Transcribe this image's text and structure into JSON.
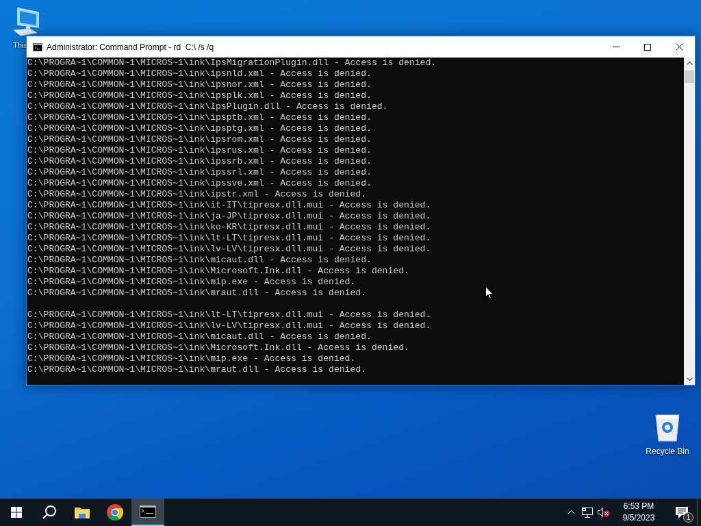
{
  "desktop_icons": [
    {
      "kind": "computer",
      "label": "This"
    },
    {
      "kind": "recycle-bin",
      "label": "Recycle Bin"
    }
  ],
  "window": {
    "title": "Administrator: Command Prompt - rd  C:\\ /s /q",
    "console_blocks": [
      [
        "C:\\PROGRA~1\\COMMON~1\\MICROS~1\\ink\\IpsMigrationPlugin.dll - Access is denied.",
        "C:\\PROGRA~1\\COMMON~1\\MICROS~1\\ink\\ipsnld.xml - Access is denied.",
        "C:\\PROGRA~1\\COMMON~1\\MICROS~1\\ink\\ipsnor.xml - Access is denied.",
        "C:\\PROGRA~1\\COMMON~1\\MICROS~1\\ink\\ipsplk.xml - Access is denied.",
        "C:\\PROGRA~1\\COMMON~1\\MICROS~1\\ink\\IpsPlugin.dll - Access is denied.",
        "C:\\PROGRA~1\\COMMON~1\\MICROS~1\\ink\\ipsptb.xml - Access is denied.",
        "C:\\PROGRA~1\\COMMON~1\\MICROS~1\\ink\\ipsptg.xml - Access is denied.",
        "C:\\PROGRA~1\\COMMON~1\\MICROS~1\\ink\\ipsrom.xml - Access is denied.",
        "C:\\PROGRA~1\\COMMON~1\\MICROS~1\\ink\\ipsrus.xml - Access is denied.",
        "C:\\PROGRA~1\\COMMON~1\\MICROS~1\\ink\\ipssrb.xml - Access is denied.",
        "C:\\PROGRA~1\\COMMON~1\\MICROS~1\\ink\\ipssrl.xml - Access is denied.",
        "C:\\PROGRA~1\\COMMON~1\\MICROS~1\\ink\\ipssve.xml - Access is denied.",
        "C:\\PROGRA~1\\COMMON~1\\MICROS~1\\ink\\ipstr.xml - Access is denied.",
        "C:\\PROGRA~1\\COMMON~1\\MICROS~1\\ink\\it-IT\\tipresx.dll.mui - Access is denied.",
        "C:\\PROGRA~1\\COMMON~1\\MICROS~1\\ink\\ja-JP\\tipresx.dll.mui - Access is denied.",
        "C:\\PROGRA~1\\COMMON~1\\MICROS~1\\ink\\ko-KR\\tipresx.dll.mui - Access is denied.",
        "C:\\PROGRA~1\\COMMON~1\\MICROS~1\\ink\\lt-LT\\tipresx.dll.mui - Access is denied.",
        "C:\\PROGRA~1\\COMMON~1\\MICROS~1\\ink\\lv-LV\\tipresx.dll.mui - Access is denied.",
        "C:\\PROGRA~1\\COMMON~1\\MICROS~1\\ink\\micaut.dll - Access is denied.",
        "C:\\PROGRA~1\\COMMON~1\\MICROS~1\\ink\\Microsoft.Ink.dll - Access is denied.",
        "C:\\PROGRA~1\\COMMON~1\\MICROS~1\\ink\\mip.exe - Access is denied.",
        "C:\\PROGRA~1\\COMMON~1\\MICROS~1\\ink\\mraut.dll - Access is denied."
      ],
      [
        "C:\\PROGRA~1\\COMMON~1\\MICROS~1\\ink\\lt-LT\\tipresx.dll.mui - Access is denied.",
        "C:\\PROGRA~1\\COMMON~1\\MICROS~1\\ink\\lv-LV\\tipresx.dll.mui - Access is denied.",
        "C:\\PROGRA~1\\COMMON~1\\MICROS~1\\ink\\micaut.dll - Access is denied.",
        "C:\\PROGRA~1\\COMMON~1\\MICROS~1\\ink\\Microsoft.Ink.dll - Access is denied.",
        "C:\\PROGRA~1\\COMMON~1\\MICROS~1\\ink\\mip.exe - Access is denied.",
        "C:\\PROGRA~1\\COMMON~1\\MICROS~1\\ink\\mraut.dll - Access is denied."
      ]
    ]
  },
  "taskbar": {
    "buttons": [
      {
        "kind": "start",
        "selected": false
      },
      {
        "kind": "search",
        "selected": false
      },
      {
        "kind": "folder",
        "selected": false
      },
      {
        "kind": "browser",
        "selected": false
      },
      {
        "kind": "console",
        "selected": true
      }
    ],
    "volume_muted": true,
    "time": "6:53 PM",
    "date": "9/5/2023",
    "notification_count": "1"
  }
}
